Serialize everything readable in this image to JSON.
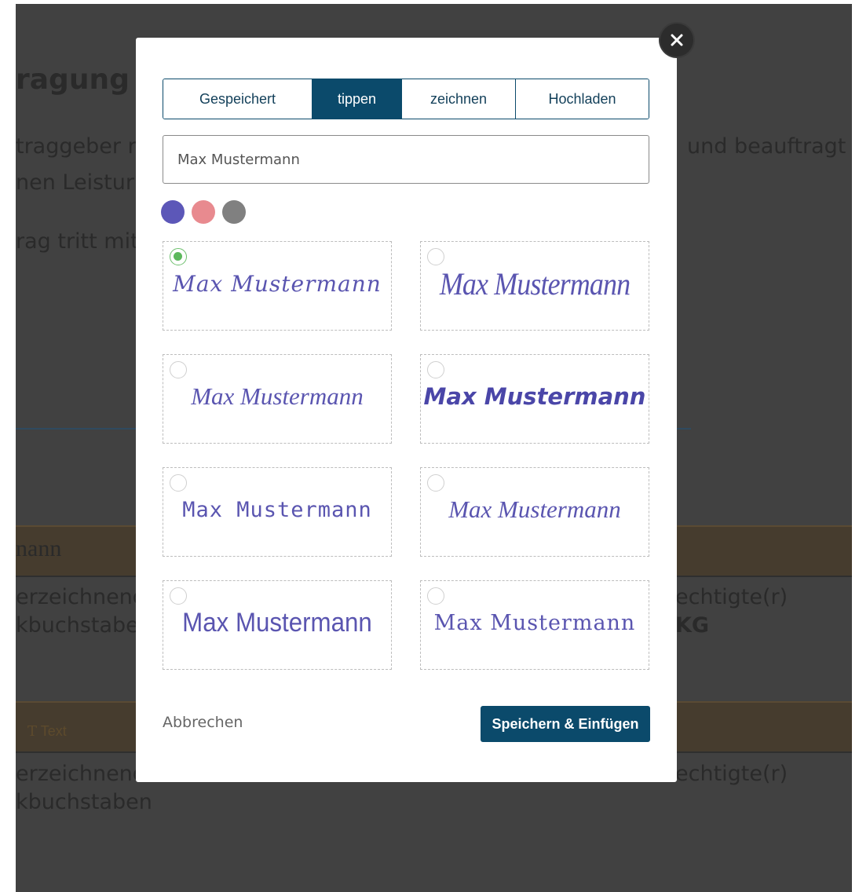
{
  "background": {
    "heading": "ragung",
    "line1_left": "traggeber r",
    "line1_right": "und beauftragt",
    "line2_left": "nen Leistur",
    "line3_left": "rag tritt mit",
    "name_heading": "nann",
    "label1_left": "erzeichnend",
    "label1_right": "echtigte(r)",
    "label2_left": "kbuchstabe",
    "label2_right": "KG",
    "band_text": "Text",
    "label3_left": "erzeichnend",
    "label3_right": "echtigte(r)",
    "label4_left": "kbuchstaben"
  },
  "modal": {
    "tabs": [
      {
        "label": "Gespeichert",
        "active": false
      },
      {
        "label": "tippen",
        "active": true
      },
      {
        "label": "zeichnen",
        "active": false
      },
      {
        "label": "Hochladen",
        "active": false
      }
    ],
    "name_value": "Max Mustermann",
    "colors": [
      "#5c57b8",
      "#e88a8f",
      "#808080"
    ],
    "signature_options": [
      {
        "text": "Max Mustermann",
        "selected": true
      },
      {
        "text": "Max Mustermann",
        "selected": false
      },
      {
        "text": "Max Mustermann",
        "selected": false
      },
      {
        "text": "Max Mustermann",
        "selected": false
      },
      {
        "text": "Max Mustermann",
        "selected": false
      },
      {
        "text": "Max Mustermann",
        "selected": false
      },
      {
        "text": "Max Mustermann",
        "selected": false
      },
      {
        "text": "Max Mustermann",
        "selected": false
      }
    ],
    "cancel_label": "Abbrechen",
    "save_label": "Speichern & Einfügen",
    "close_icon": "close-icon"
  }
}
